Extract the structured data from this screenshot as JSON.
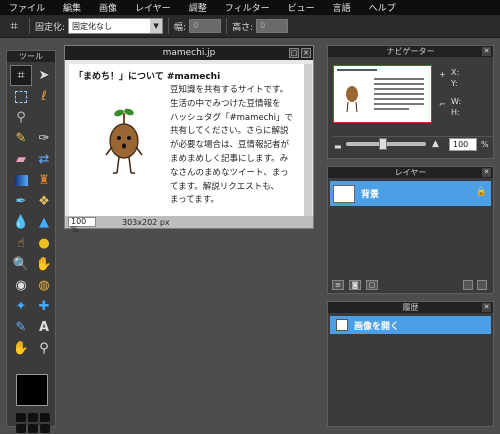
{
  "menu": [
    "ファイル",
    "編集",
    "画像",
    "レイヤー",
    "調整",
    "フィルター",
    "ビュー",
    "言語",
    "ヘルプ"
  ],
  "options": {
    "ratio_label": "固定化:",
    "ratio_value": "固定化なし",
    "width_label": "幅:",
    "width_value": "0",
    "height_label": "高さ:",
    "height_value": "0"
  },
  "tools": {
    "title": "ツール"
  },
  "document": {
    "title": "mamechi.jp",
    "heading": "「まめち！」について #mamechi",
    "body": "豆知識を共有するサイトです。\n生活の中でみつけた豆情報を\nハッシュタグ「#mamechi」で\n共有してください。さらに解説\nが必要な場合は、豆情報記者が\nまめまめしく記事にします。み\nなさんのまめなツイート、まっ\nてます。解説リクエストも、\nまってます。",
    "zoom": "100",
    "zoom_unit": "%",
    "size": "303x202 px"
  },
  "navigator": {
    "title": "ナビゲーター",
    "x_label": "X:",
    "y_label": "Y:",
    "w_label": "W:",
    "h_label": "H:",
    "zoom": "100",
    "zoom_unit": "%"
  },
  "layers": {
    "title": "レイヤー",
    "items": [
      {
        "name": "背景"
      }
    ]
  },
  "history": {
    "title": "履歴",
    "items": [
      {
        "label": "画像を開く"
      }
    ]
  },
  "colors": {
    "accent": "#4c9fe4",
    "panel_bg": "#3b3b3b",
    "menubar_bg": "#0e0e0e"
  }
}
